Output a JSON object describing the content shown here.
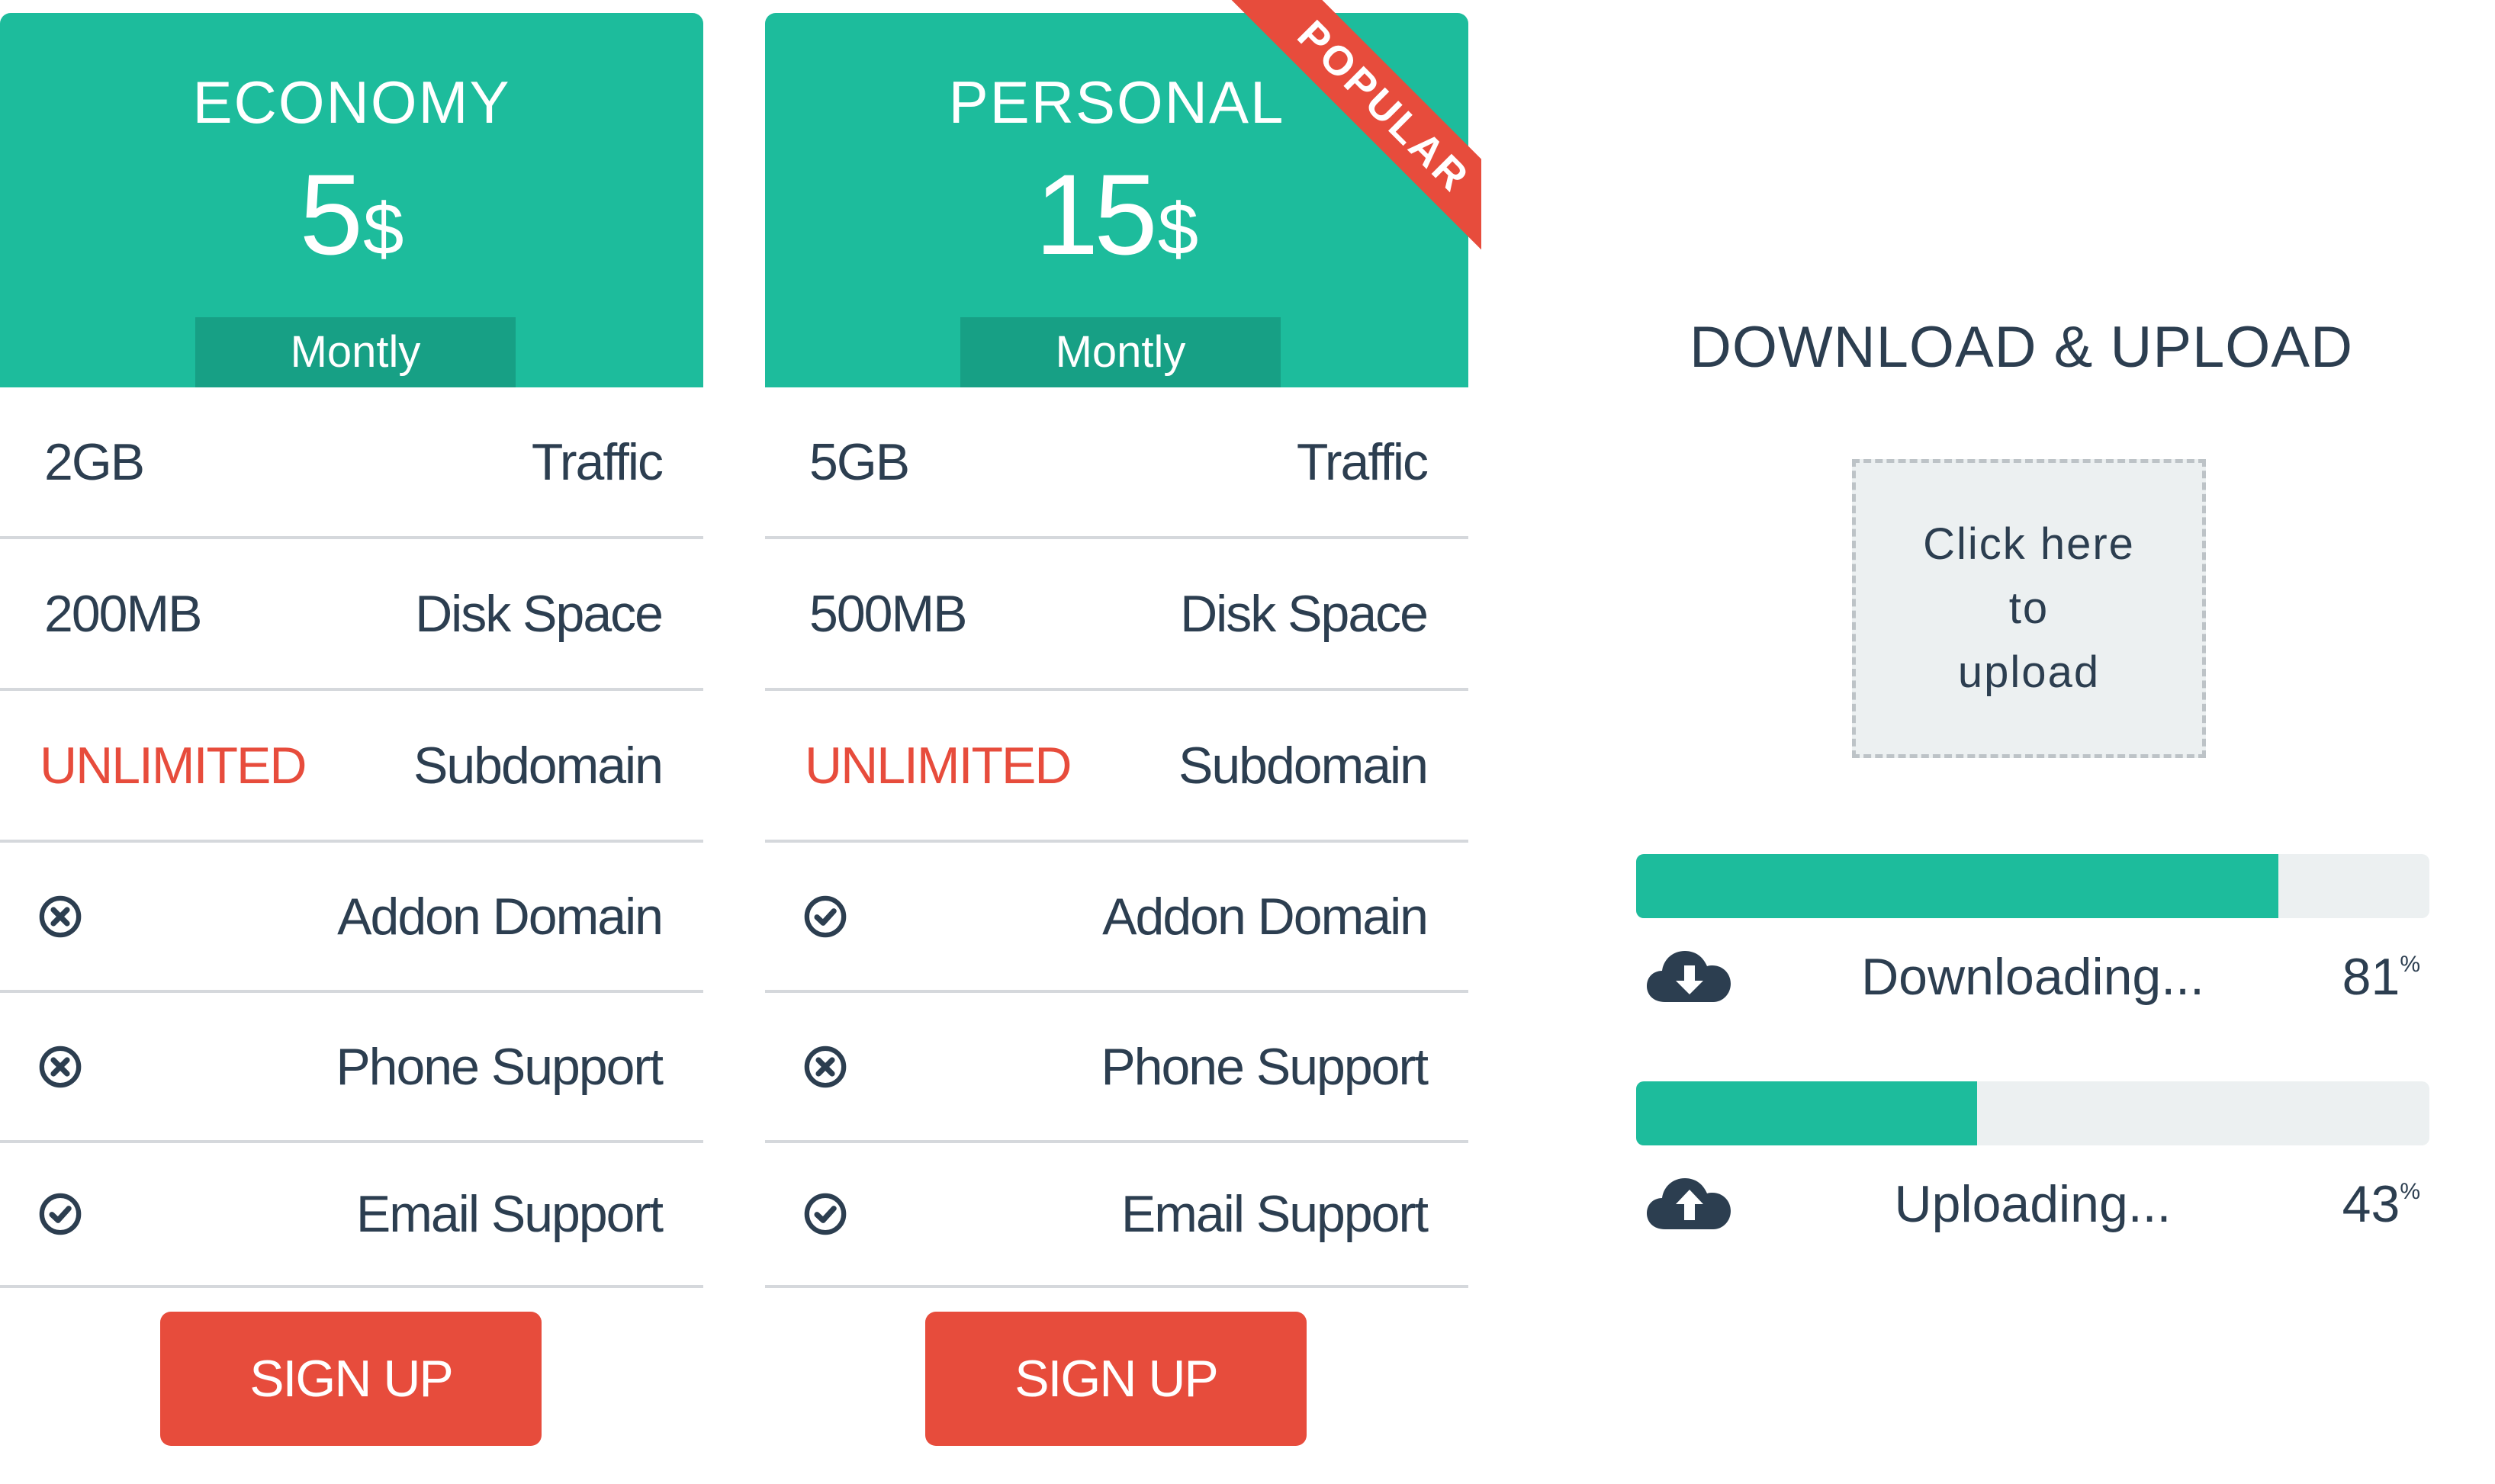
{
  "plans": [
    {
      "name": "ECONOMY",
      "price": "5",
      "currency": "$",
      "period": "Montly",
      "features": [
        {
          "value": "2GB",
          "label": "Traffic"
        },
        {
          "value": "200MB",
          "label": "Disk Space"
        },
        {
          "value": "UNLIMITED",
          "label": "Subdomain"
        },
        {
          "icon": "x-circle-icon",
          "label": "Addon Domain"
        },
        {
          "icon": "x-circle-icon",
          "label": "Phone Support"
        },
        {
          "icon": "check-circle-icon",
          "label": "Email Support"
        }
      ],
      "signup_label": "SIGN UP"
    },
    {
      "name": "PERSONAL",
      "price": "15",
      "currency": "$",
      "period": "Montly",
      "ribbon": "POPULAR",
      "features": [
        {
          "value": "5GB",
          "label": "Traffic"
        },
        {
          "value": "500MB",
          "label": "Disk Space"
        },
        {
          "value": "UNLIMITED",
          "label": "Subdomain"
        },
        {
          "icon": "check-circle-icon",
          "label": "Addon Domain"
        },
        {
          "icon": "x-circle-icon",
          "label": "Phone Support"
        },
        {
          "icon": "check-circle-icon",
          "label": "Email Support"
        }
      ],
      "signup_label": "SIGN UP"
    }
  ],
  "transfer": {
    "title": "DOWNLOAD & UPLOAD",
    "dropzone": [
      "Click here",
      "to",
      "upload"
    ],
    "download": {
      "label": "Downloading...",
      "percent": 81,
      "percent_text": "81",
      "unit": "%",
      "icon": "cloud-download-icon"
    },
    "upload": {
      "label": "Uploading...",
      "percent": 43,
      "percent_text": "43",
      "unit": "%",
      "icon": "cloud-upload-icon"
    }
  },
  "colors": {
    "primary": "#1dbc9c",
    "primary_dark": "#17a085",
    "accent": "#e74c3c",
    "text": "#2c3e50",
    "track": "#ecf0f1",
    "divider": "#d5d8dc"
  }
}
